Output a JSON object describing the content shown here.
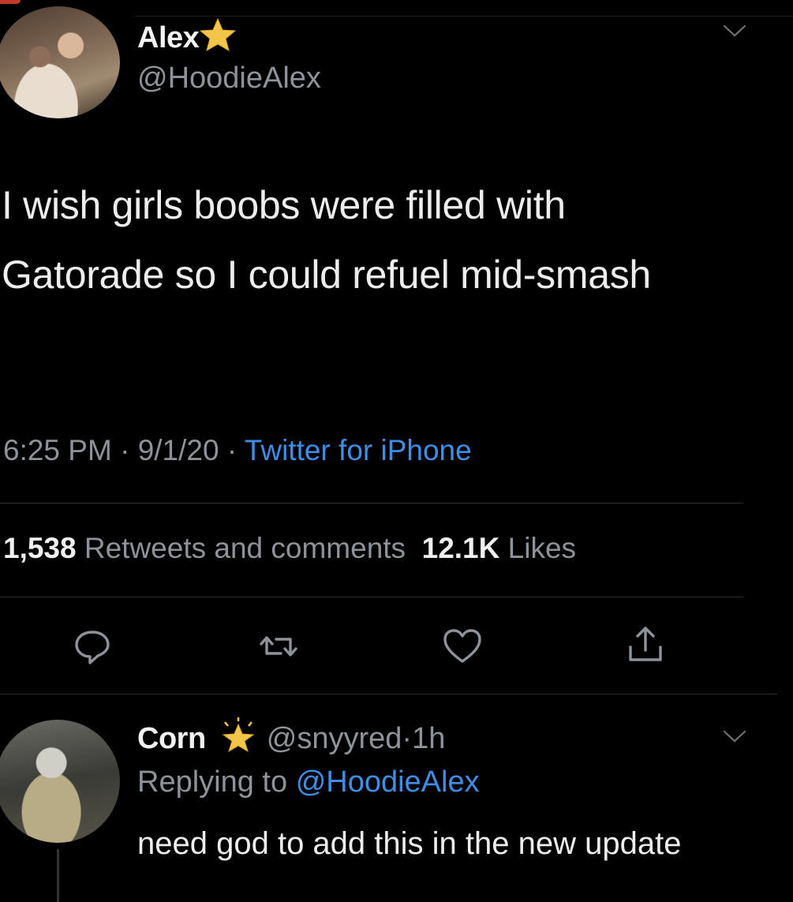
{
  "tweet": {
    "author_name": "Alex",
    "author_handle": "@HoodieAlex",
    "text": "I wish girls boobs were filled with Gatorade so I could refuel mid-smash",
    "time": "6:25 PM",
    "date": "9/1/20",
    "source": "Twitter for iPhone",
    "separator": "·",
    "retweets_count": "1,538",
    "retweets_label": "Retweets and comments",
    "likes_count": "12.1K",
    "likes_label": "Likes"
  },
  "reply": {
    "author_name": "Corn",
    "author_handle": "@snyyred",
    "separator": "·",
    "time_ago": "1h",
    "replying_prefix": "Replying to",
    "replying_to": "@HoodieAlex",
    "text": "need god to add this in the new update"
  },
  "icons": {
    "name_badge": "star-icon",
    "reply_badge": "sparkle-star-icon",
    "menu": "chevron-down-icon",
    "actions": [
      "reply-icon",
      "retweet-icon",
      "like-icon",
      "share-icon"
    ]
  },
  "colors": {
    "background": "#000000",
    "text": "#ededed",
    "secondary": "#8d9399",
    "link": "#3d8ee6",
    "star": "#f3c64a"
  }
}
